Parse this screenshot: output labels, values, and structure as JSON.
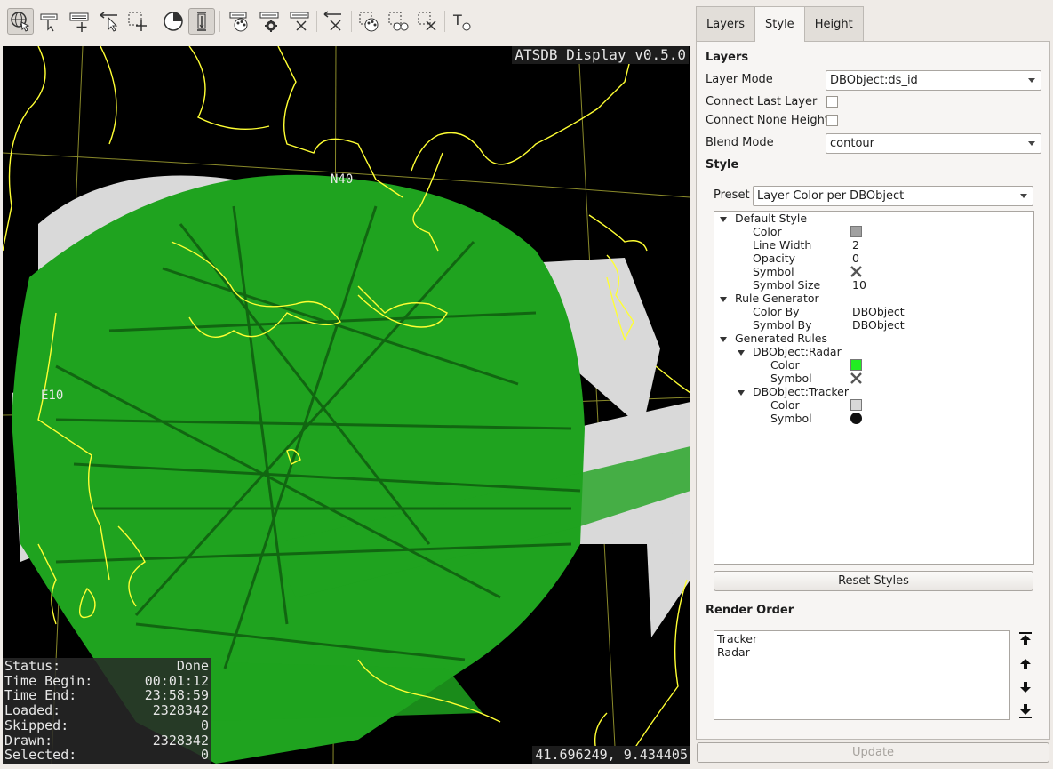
{
  "toolbar": {
    "buttons": [
      {
        "name": "navigate-globe-icon",
        "active": true
      },
      {
        "name": "select-labels-icon",
        "active": false
      },
      {
        "name": "add-label-icon",
        "active": false
      },
      {
        "name": "select-arrow-icon",
        "active": false
      },
      {
        "name": "add-rect-icon",
        "active": false
      },
      {
        "name": "time-filter-icon",
        "active": false
      },
      {
        "name": "height-filter-icon",
        "active": true
      },
      {
        "name": "style-palette-icon",
        "active": false
      },
      {
        "name": "label-settings-icon",
        "active": false
      },
      {
        "name": "clear-labels-icon",
        "active": false
      },
      {
        "name": "clear-selection-icon",
        "active": false
      },
      {
        "name": "select-palette-icon",
        "active": false
      },
      {
        "name": "select-circles-icon",
        "active": false
      },
      {
        "name": "clear-rect-icon",
        "active": false
      },
      {
        "name": "text-cursor-icon",
        "active": false
      }
    ]
  },
  "map": {
    "title": "ATSDB Display v0.5.0",
    "grid_labels": {
      "n40": "N40",
      "e10": "E10"
    },
    "coords": "41.696249, 9.434405",
    "status": [
      {
        "label": "Status:",
        "value": "Done"
      },
      {
        "label": "Time Begin:",
        "value": "00:01:12"
      },
      {
        "label": "Time End:",
        "value": "23:58:59"
      },
      {
        "label": "Loaded:",
        "value": "2328342"
      },
      {
        "label": "Skipped:",
        "value": "0"
      },
      {
        "label": "Drawn:",
        "value": "2328342"
      },
      {
        "label": "Selected:",
        "value": "0"
      }
    ],
    "colors": {
      "background": "#000000",
      "borders": "#ffff33",
      "radar": "#22dd22",
      "tracker": "#dddddd",
      "grid": "#9a9a3a"
    }
  },
  "tabs": {
    "layers": "Layers",
    "style": "Style",
    "height": "Height",
    "active": "Style"
  },
  "panel": {
    "layers_title": "Layers",
    "layer_mode_label": "Layer Mode",
    "layer_mode_value": "DBObject:ds_id",
    "connect_last_layer": "Connect Last Layer",
    "connect_none_height": "Connect None Height",
    "blend_mode_label": "Blend Mode",
    "blend_mode_value": "contour",
    "style_title": "Style",
    "preset_label": "Preset",
    "preset_value": "Layer Color per DBObject",
    "tree": {
      "default_style": "Default Style",
      "color": "Color",
      "line_width": "Line Width",
      "line_width_value": "2",
      "opacity": "Opacity",
      "opacity_value": "0",
      "symbol": "Symbol",
      "symbol_size": "Symbol Size",
      "symbol_size_value": "10",
      "rule_generator": "Rule Generator",
      "color_by": "Color By",
      "color_by_value": "DBObject",
      "symbol_by": "Symbol By",
      "symbol_by_value": "DBObject",
      "generated_rules": "Generated Rules",
      "radar": "DBObject:Radar",
      "tracker": "DBObject:Tracker",
      "default_color": "#a0a0a0",
      "radar_color": "#22ee22",
      "tracker_color": "#d8d8d8"
    },
    "reset_styles": "Reset Styles",
    "render_order_title": "Render Order",
    "render_order": [
      "Tracker",
      "Radar"
    ],
    "update": "Update"
  }
}
